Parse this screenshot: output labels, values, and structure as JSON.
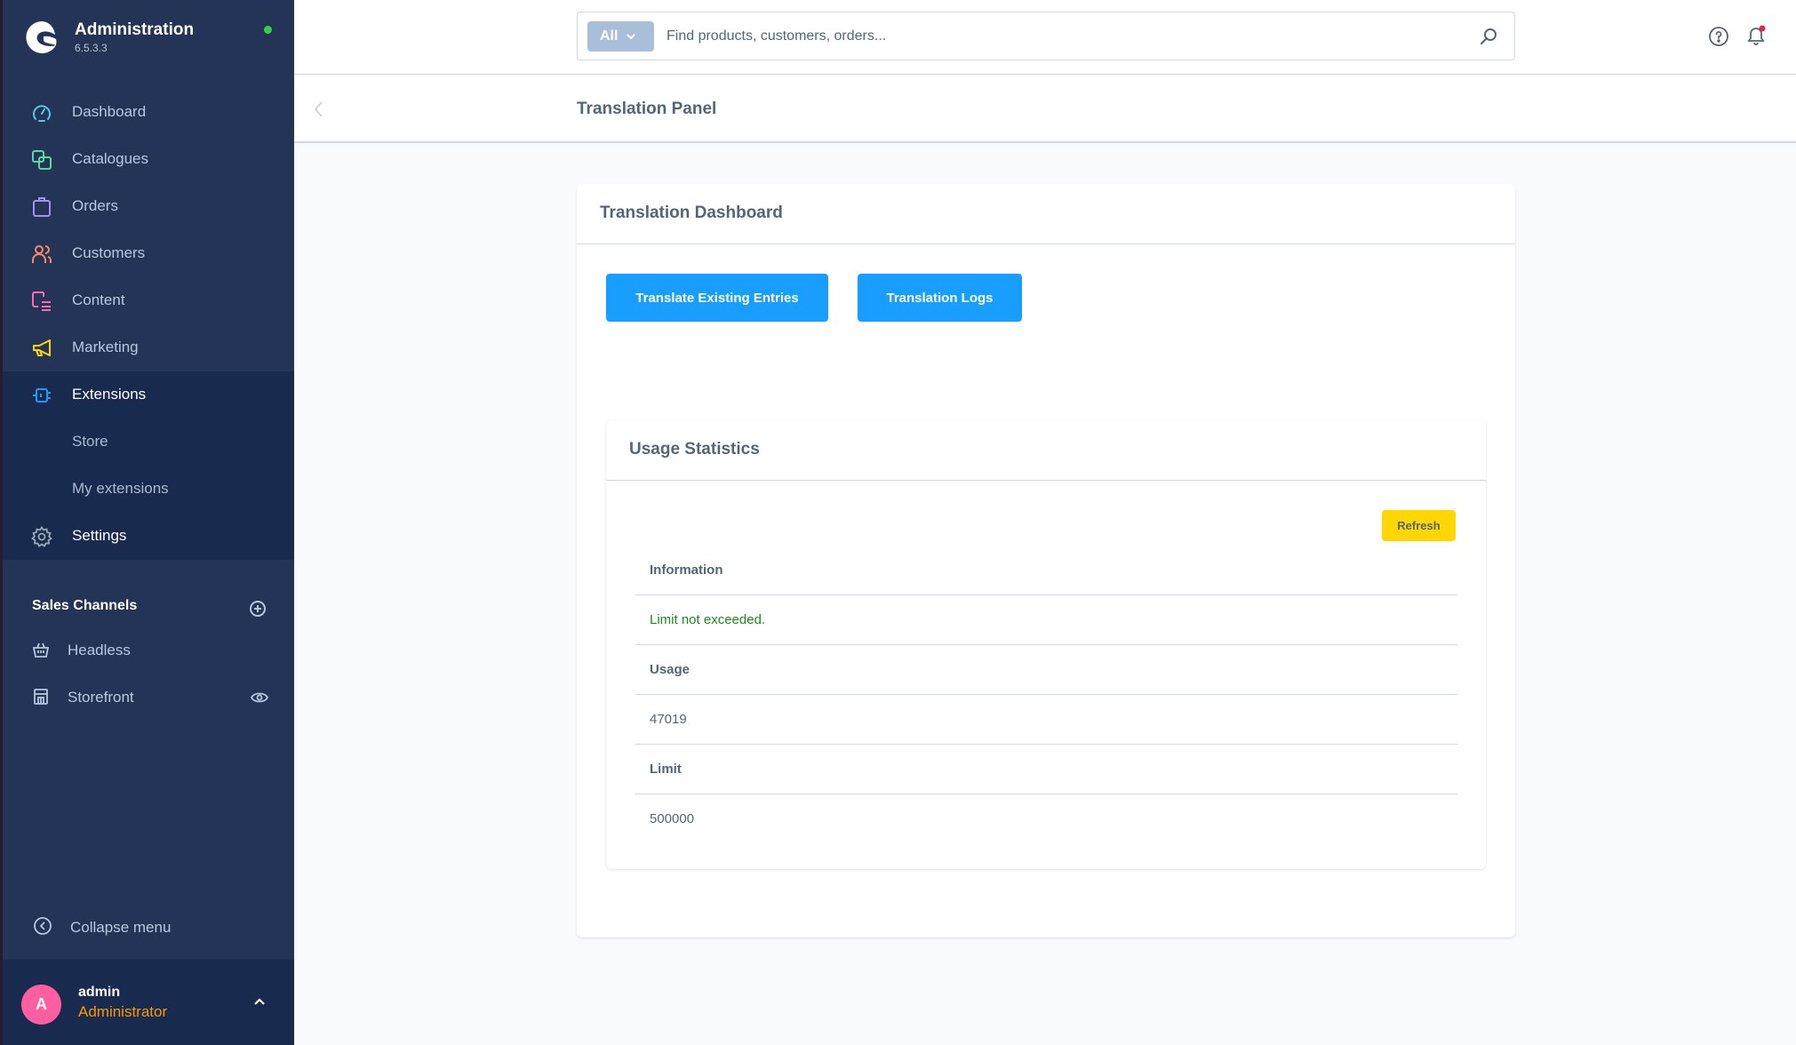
{
  "app": {
    "title": "Administration",
    "version": "6.5.3.3",
    "status_color": "#37d046"
  },
  "sidebar": {
    "items": [
      {
        "label": "Dashboard",
        "icon": "dashboard-icon",
        "color": "#56c7e8"
      },
      {
        "label": "Catalogues",
        "icon": "catalogues-icon",
        "color": "#57d9a3"
      },
      {
        "label": "Orders",
        "icon": "orders-icon",
        "color": "#a092f0"
      },
      {
        "label": "Customers",
        "icon": "customers-icon",
        "color": "#f88962"
      },
      {
        "label": "Content",
        "icon": "content-icon",
        "color": "#ff68b4"
      },
      {
        "label": "Marketing",
        "icon": "marketing-icon",
        "color": "#ffd700"
      },
      {
        "label": "Extensions",
        "icon": "extensions-icon",
        "color": "#189eff"
      },
      {
        "label": "Settings",
        "icon": "settings-icon",
        "color": "#9aa8b5"
      }
    ],
    "extensions_children": [
      {
        "label": "Store"
      },
      {
        "label": "My extensions"
      }
    ],
    "sales_channels": {
      "title": "Sales Channels",
      "items": [
        {
          "label": "Headless",
          "icon": "basket-icon"
        },
        {
          "label": "Storefront",
          "icon": "storefront-icon"
        }
      ]
    },
    "collapse_label": "Collapse menu",
    "user": {
      "initial": "A",
      "name": "admin",
      "role": "Administrator"
    }
  },
  "header": {
    "search_type": "All",
    "search_placeholder": "Find products, customers, orders..."
  },
  "smartbar": {
    "title": "Translation Panel"
  },
  "main": {
    "card_title": "Translation Dashboard",
    "buttons": {
      "translate": "Translate Existing Entries",
      "logs": "Translation Logs"
    },
    "usage": {
      "title": "Usage Statistics",
      "refresh_label": "Refresh",
      "rows": [
        {
          "label": "Information"
        },
        {
          "value": "Limit not exceeded."
        },
        {
          "label": "Usage"
        },
        {
          "value": "47019"
        },
        {
          "label": "Limit"
        },
        {
          "value": "500000"
        }
      ]
    }
  },
  "colors": {
    "primary": "#189eff",
    "refresh": "#ffd700",
    "sidebar_bg": "#243456",
    "success_text": "#1c8a1c"
  }
}
